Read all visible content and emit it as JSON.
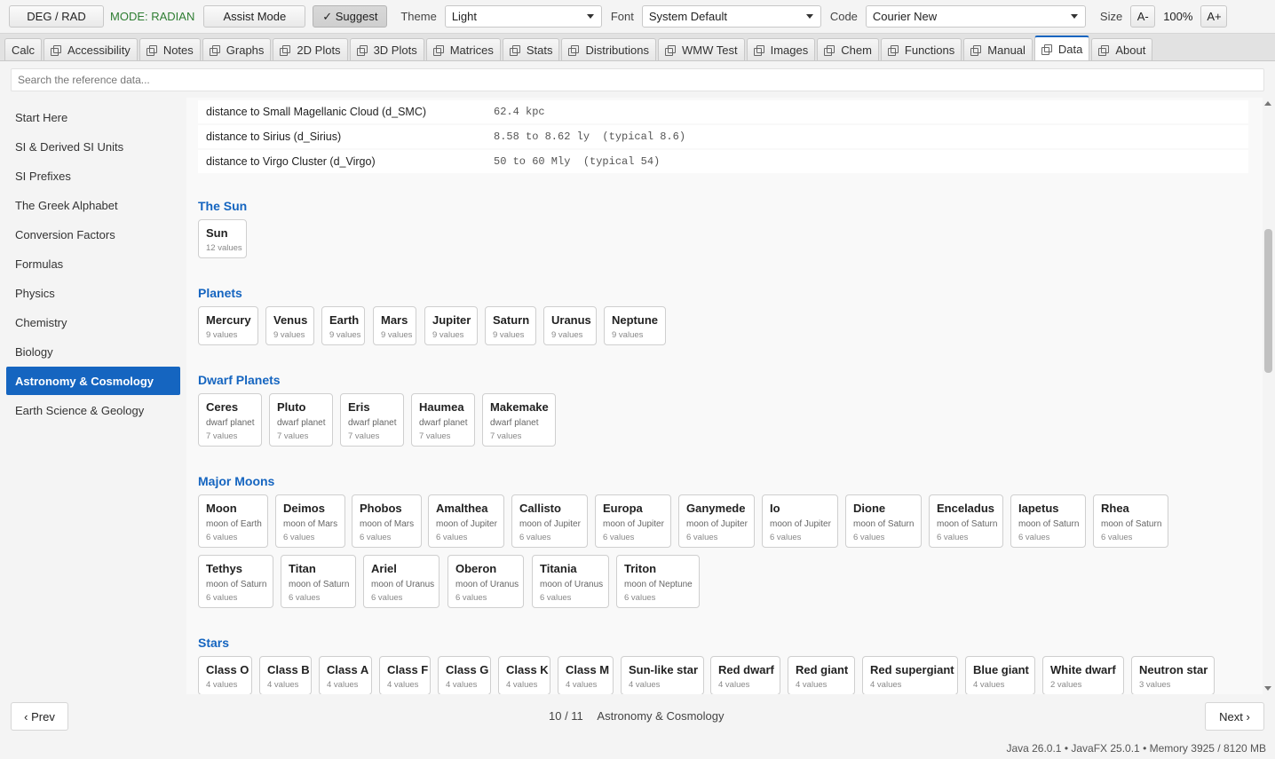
{
  "toolbar": {
    "deg_rad_label": "DEG / RAD",
    "mode_text": "MODE: RADIAN",
    "assist_label": "Assist Mode",
    "suggest_label": "✓ Suggest",
    "theme_label": "Theme",
    "theme_value": "Light",
    "font_label": "Font",
    "font_value": "System Default",
    "code_label": "Code",
    "code_value": "Courier New",
    "size_label": "Size",
    "size_down": "A-",
    "size_value": "100%",
    "size_up": "A+",
    "accent_color": "#1565c0",
    "mode_color": "#2e7d32"
  },
  "tabs": [
    "Calc",
    "Accessibility",
    "Notes",
    "Graphs",
    "2D Plots",
    "3D Plots",
    "Matrices",
    "Stats",
    "Distributions",
    "WMW Test",
    "Images",
    "Chem",
    "Functions",
    "Manual",
    "Data",
    "About"
  ],
  "active_tab": "Data",
  "search": {
    "placeholder": "Search the reference data..."
  },
  "sidebar": {
    "items": [
      "Start Here",
      "SI & Derived SI Units",
      "SI Prefixes",
      "The Greek Alphabet",
      "Conversion Factors",
      "Formulas",
      "Physics",
      "Chemistry",
      "Biology",
      "Astronomy & Cosmology",
      "Earth Science & Geology"
    ],
    "active": "Astronomy & Cosmology"
  },
  "data_rows": [
    {
      "label": "distance to Small Magellanic Cloud  (d_SMC)",
      "value": "62.4 kpc"
    },
    {
      "label": "distance to Sirius  (d_Sirius)",
      "value": "8.58 to 8.62 ly  (typical 8.6)"
    },
    {
      "label": "distance to Virgo Cluster  (d_Virgo)",
      "value": "50 to 60 Mly  (typical 54)"
    }
  ],
  "sections": {
    "sun": {
      "title": "The Sun",
      "cards": [
        {
          "name": "Sun",
          "count": "12 values"
        }
      ]
    },
    "planets": {
      "title": "Planets",
      "cards": [
        {
          "name": "Mercury",
          "count": "9 values"
        },
        {
          "name": "Venus",
          "count": "9 values"
        },
        {
          "name": "Earth",
          "count": "9 values"
        },
        {
          "name": "Mars",
          "count": "9 values"
        },
        {
          "name": "Jupiter",
          "count": "9 values"
        },
        {
          "name": "Saturn",
          "count": "9 values"
        },
        {
          "name": "Uranus",
          "count": "9 values"
        },
        {
          "name": "Neptune",
          "count": "9 values"
        }
      ]
    },
    "dwarf": {
      "title": "Dwarf Planets",
      "cards": [
        {
          "name": "Ceres",
          "sub": "dwarf planet",
          "count": "7 values"
        },
        {
          "name": "Pluto",
          "sub": "dwarf planet",
          "count": "7 values"
        },
        {
          "name": "Eris",
          "sub": "dwarf planet",
          "count": "7 values"
        },
        {
          "name": "Haumea",
          "sub": "dwarf planet",
          "count": "7 values"
        },
        {
          "name": "Makemake",
          "sub": "dwarf planet",
          "count": "7 values"
        }
      ]
    },
    "moons": {
      "title": "Major Moons",
      "cards": [
        {
          "name": "Moon",
          "sub": "moon of Earth",
          "count": "6 values"
        },
        {
          "name": "Deimos",
          "sub": "moon of Mars",
          "count": "6 values"
        },
        {
          "name": "Phobos",
          "sub": "moon of Mars",
          "count": "6 values"
        },
        {
          "name": "Amalthea",
          "sub": "moon of Jupiter",
          "count": "6 values"
        },
        {
          "name": "Callisto",
          "sub": "moon of Jupiter",
          "count": "6 values"
        },
        {
          "name": "Europa",
          "sub": "moon of Jupiter",
          "count": "6 values"
        },
        {
          "name": "Ganymede",
          "sub": "moon of Jupiter",
          "count": "6 values"
        },
        {
          "name": "Io",
          "sub": "moon of Jupiter",
          "count": "6 values"
        },
        {
          "name": "Dione",
          "sub": "moon of Saturn",
          "count": "6 values"
        },
        {
          "name": "Enceladus",
          "sub": "moon of Saturn",
          "count": "6 values"
        },
        {
          "name": "Iapetus",
          "sub": "moon of Saturn",
          "count": "6 values"
        },
        {
          "name": "Rhea",
          "sub": "moon of Saturn",
          "count": "6 values"
        },
        {
          "name": "Tethys",
          "sub": "moon of Saturn",
          "count": "6 values"
        },
        {
          "name": "Titan",
          "sub": "moon of Saturn",
          "count": "6 values"
        },
        {
          "name": "Ariel",
          "sub": "moon of Uranus",
          "count": "6 values"
        },
        {
          "name": "Oberon",
          "sub": "moon of Uranus",
          "count": "6 values"
        },
        {
          "name": "Titania",
          "sub": "moon of Uranus",
          "count": "6 values"
        },
        {
          "name": "Triton",
          "sub": "moon of Neptune",
          "count": "6 values"
        }
      ]
    },
    "stars": {
      "title": "Stars",
      "cards": [
        {
          "name": "Class O",
          "count": "4 values"
        },
        {
          "name": "Class B",
          "count": "4 values"
        },
        {
          "name": "Class A",
          "count": "4 values"
        },
        {
          "name": "Class F",
          "count": "4 values"
        },
        {
          "name": "Class G",
          "count": "4 values"
        },
        {
          "name": "Class K",
          "count": "4 values"
        },
        {
          "name": "Class M",
          "count": "4 values"
        },
        {
          "name": "Sun-like star",
          "count": "4 values"
        },
        {
          "name": "Red dwarf",
          "count": "4 values"
        },
        {
          "name": "Red giant",
          "count": "4 values"
        },
        {
          "name": "Red supergiant",
          "count": "4 values"
        },
        {
          "name": "Blue giant",
          "count": "4 values"
        },
        {
          "name": "White dwarf",
          "count": "2 values"
        },
        {
          "name": "Neutron star",
          "count": "3 values"
        }
      ]
    }
  },
  "footer": {
    "prev_label": "‹ Prev",
    "next_label": "Next ›",
    "page_indicator": "10 / 11",
    "page_title": "Astronomy & Cosmology",
    "status": "Java 26.0.1  •  JavaFX 25.0.1  •  Memory 3925 / 8120 MB"
  }
}
